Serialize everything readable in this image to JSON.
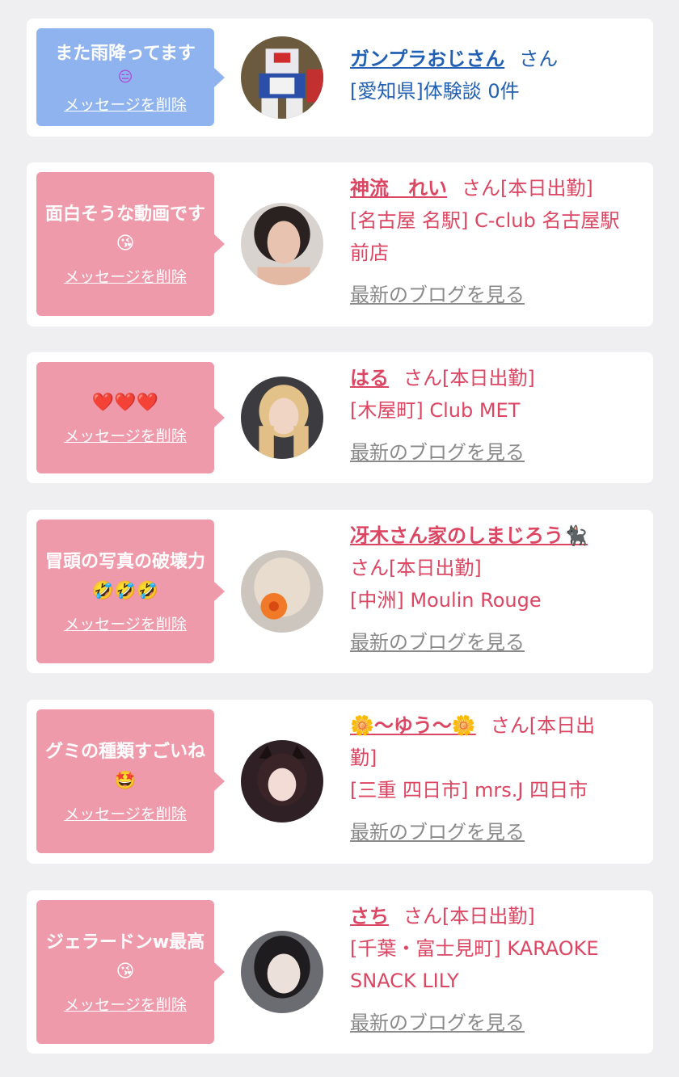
{
  "delete_label": "メッセージを削除",
  "blog_label": "最新のブログを見る",
  "cards": [
    {
      "message": "また雨降ってます",
      "message_emoji": "😑",
      "name": "ガンプラおじさん",
      "suffix": "さん",
      "line1": "[愛知県]体験談 0件",
      "line2": ""
    },
    {
      "message": "面白そうな動画です😘",
      "name": "神流　れい",
      "suffix": "さん[本日出勤]",
      "line1": "[名古屋 名駅] C-club 名古屋駅",
      "line2": "前店"
    },
    {
      "message": "❤️❤️❤️",
      "name": "はる",
      "suffix": "さん[本日出勤]",
      "line1": "[木屋町] Club MET",
      "line2": ""
    },
    {
      "message": "冒頭の写真の破壊力🤣🤣🤣",
      "name": "冴木さん家のしまじろう🐈‍⬛",
      "suffix": "さん[本日出勤]",
      "line1": "[中洲] Moulin Rouge",
      "line2": ""
    },
    {
      "message": "グミの種類すごいね🤩",
      "name": "🌼〜ゆう〜🌼",
      "suffix": "さん[本日出",
      "suffix2": "勤]",
      "line1": "[三重 四日市] mrs.J 四日市",
      "line2": ""
    },
    {
      "message": "ジェラードンw最高😘",
      "name": "さち",
      "suffix": "さん[本日出勤]",
      "line1": "[千葉・富士見町] KARAOKE",
      "line2": "SNACK LILY"
    }
  ],
  "colors": {
    "blue_accent": "#2260b4",
    "pink_accent": "#dc4662",
    "blue_bubble": "#8fb3ee",
    "pink_bubble": "#ef9aaa"
  }
}
